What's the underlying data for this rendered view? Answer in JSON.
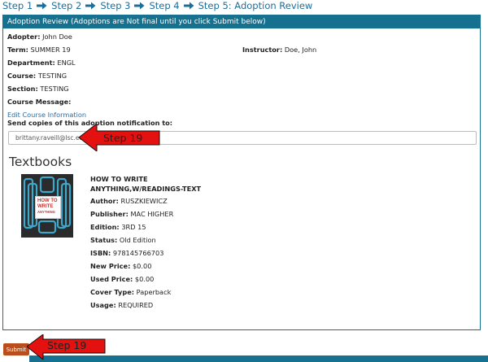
{
  "steps": [
    {
      "label": "Step 1"
    },
    {
      "label": "Step 2"
    },
    {
      "label": "Step 3"
    },
    {
      "label": "Step 4"
    },
    {
      "label": "Step 5: Adoption Review"
    }
  ],
  "panel": {
    "header": "Adoption Review (Adoptions are Not final until you click Submit below)"
  },
  "adoption": {
    "adopter_label": "Adopter:",
    "adopter_value": "John Doe",
    "term_label": "Term:",
    "term_value": "SUMMER 19",
    "instructor_label": "Instructor:",
    "instructor_value": "Doe, John",
    "department_label": "Department:",
    "department_value": "ENGL",
    "course_label": "Course:",
    "course_value": "TESTING",
    "section_label": "Section:",
    "section_value": "TESTING",
    "message_label": "Course Message:",
    "message_value": ""
  },
  "edit_link": "Edit Course Information",
  "notify": {
    "label": "Send copies of this adoption notification to:",
    "value": "brittany.raveill@lsc.edu"
  },
  "textbooks_title": "Textbooks",
  "book": {
    "title": "HOW TO WRITE ANYTHING,W/READINGS-TEXT",
    "cover_line1": "HOW TO",
    "cover_line2": "WRITE",
    "cover_line3": "ANYTHING",
    "author_label": "Author:",
    "author": "RUSZKIEWICZ",
    "publisher_label": "Publisher:",
    "publisher": "MAC HIGHER",
    "edition_label": "Edition:",
    "edition": "3RD 15",
    "status_label": "Status:",
    "status": "Old Edition",
    "isbn_label": "ISBN:",
    "isbn": "978145766703",
    "new_price_label": "New Price:",
    "new_price": "$0.00",
    "used_price_label": "Used Price:",
    "used_price": "$0.00",
    "cover_type_label": "Cover Type:",
    "cover_type": "Paperback",
    "usage_label": "Usage:",
    "usage": "REQUIRED"
  },
  "submit_label": "Submit",
  "annotations": {
    "callout_1": "Step 19",
    "callout_2": "Step 19"
  },
  "colors": {
    "header_bg": "#15718f",
    "link": "#2b6ca3",
    "submit_bg": "#b94e1c",
    "callout_red": "#e3110f"
  }
}
